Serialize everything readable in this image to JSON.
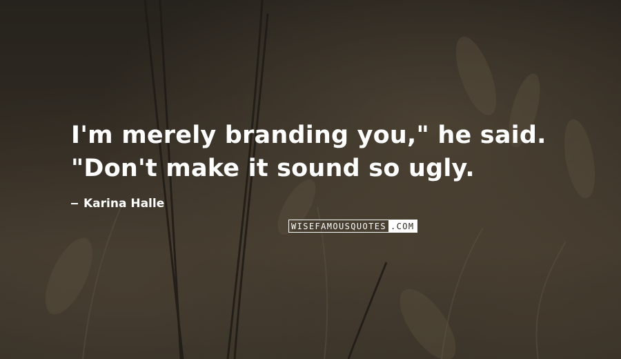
{
  "quote": {
    "lines": [
      "I'm merely branding you,\" he said.",
      "\"Don't make it sound so ugly."
    ]
  },
  "author": {
    "name": "Karina Halle"
  },
  "watermark": {
    "text_main": "WISEFAMOUSQUOTES",
    "text_suffix": ".COM"
  },
  "colors": {
    "text": "#ffffff",
    "background": "#3a3329"
  }
}
